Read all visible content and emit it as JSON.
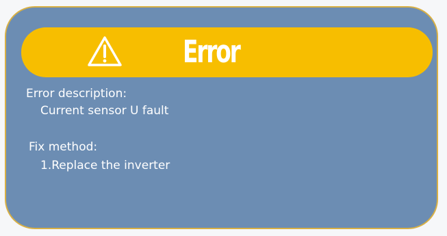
{
  "dialog": {
    "title": "Error",
    "icon": "warning-icon",
    "colors": {
      "panel": "#6c8db3",
      "header": "#f7be00",
      "border": "#d8b045",
      "text": "#ffffff"
    },
    "error_description_label": "Error description:",
    "error_description": "Current sensor U fault",
    "fix_method_label": "Fix method:",
    "fix_method": "1.Replace the inverter"
  }
}
